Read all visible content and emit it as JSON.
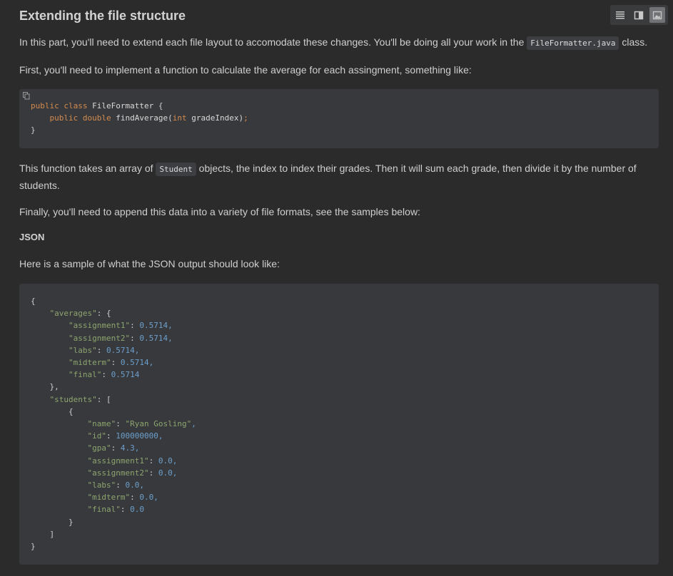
{
  "title": "Extending the file structure",
  "intro": {
    "before": "In this part, you'll need to extend each file layout to accomodate these changes. You'll be doing all your work in the ",
    "code": "FileFormatter.java",
    "after": " class."
  },
  "first": "First, you'll need to implement a function to calculate the average for each assingment, something like:",
  "code_java": {
    "kw_public": "public",
    "kw_class": "class",
    "class_name": "FileFormatter",
    "brace_open": "{",
    "kw_public2": "public",
    "kw_double": "double",
    "method": "findAverage(",
    "kw_int": "int",
    "param": "gradeIndex)",
    "semicolon": ";",
    "brace_close": "}"
  },
  "function_desc": {
    "before": "This function takes an array of ",
    "code": "Student",
    "after": " objects, the index to index their grades. Then it will sum each grade, then divide it by the number of students."
  },
  "finally": "Finally, you'll need to append this data into a variety of file formats, see the samples below:",
  "json_heading": "JSON",
  "json_intro": "Here is a sample of what the JSON output should look like:",
  "json_sample": {
    "open": "{",
    "averages_key": "\"averages\"",
    "averages": [
      {
        "key": "\"assignment1\"",
        "value": "0.5714",
        "comma": ","
      },
      {
        "key": "\"assignment2\"",
        "value": "0.5714",
        "comma": ","
      },
      {
        "key": "\"labs\"",
        "value": "0.5714",
        "comma": ","
      },
      {
        "key": "\"midterm\"",
        "value": "0.5714",
        "comma": ","
      },
      {
        "key": "\"final\"",
        "value": "0.5714",
        "comma": ""
      }
    ],
    "students_key": "\"students\"",
    "student": [
      {
        "key": "\"name\"",
        "value": "\"Ryan Gosling\"",
        "is_string": true,
        "comma": ","
      },
      {
        "key": "\"id\"",
        "value": "100000000",
        "is_string": false,
        "comma": ","
      },
      {
        "key": "\"gpa\"",
        "value": "4.3",
        "is_string": false,
        "comma": ","
      },
      {
        "key": "\"assignment1\"",
        "value": "0.0",
        "is_string": false,
        "comma": ","
      },
      {
        "key": "\"assignment2\"",
        "value": "0.0",
        "is_string": false,
        "comma": ","
      },
      {
        "key": "\"labs\"",
        "value": "0.0",
        "is_string": false,
        "comma": ","
      },
      {
        "key": "\"midterm\"",
        "value": "0.0",
        "is_string": false,
        "comma": ","
      },
      {
        "key": "\"final\"",
        "value": "0.0",
        "is_string": false,
        "comma": ""
      }
    ]
  },
  "toolbar": {
    "buttons": [
      "list-view-icon",
      "split-view-icon",
      "image-view-icon"
    ],
    "active": "image-view-icon"
  },
  "colors": {
    "background": "#2b2b2b",
    "code_background": "#38393c",
    "keyword": "#d48b4f",
    "string": "#8ca56f",
    "number": "#6c9fcc"
  }
}
